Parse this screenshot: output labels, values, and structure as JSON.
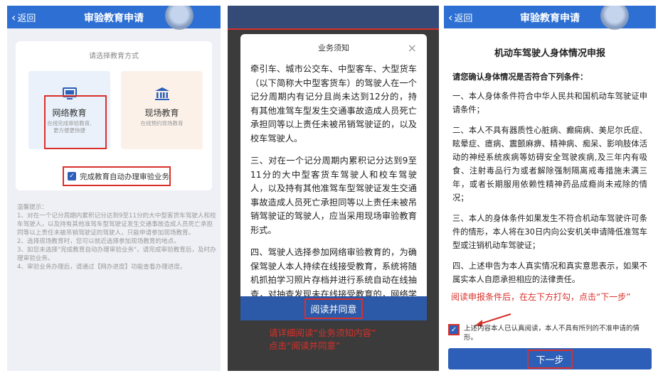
{
  "panel1": {
    "back_label": "返回",
    "title": "审验教育申请",
    "choose_hint": "请选择教育方式",
    "network": {
      "label": "网络教育",
      "sub": "在线完成审验教育,\n更方便更快捷"
    },
    "site": {
      "label": "现场教育",
      "sub": "在线预约现场教育"
    },
    "auto_option": "完成教育自动办理审验业务",
    "tips": [
      "温馨提示：",
      "1、对在一个记分周期内累积记分达到9至11分的大中型客货车驾驶人和校车驾驶人，以及持有其他准驾车型驾驶证发生交通事故造成人员死亡承担同等以上责任未被吊销驾驶证的驾驶人，只能申请参加现场教育。",
      "2、选择现场教育时，您可以就近选择参加现场教育的地点。",
      "3、如您未选择\"完成教育自动办理审验业务\"，请完成审验教育后，及时办理审验业务。",
      "4、审验业务办理后，请通过【网办进度】功能查看办理进度。"
    ]
  },
  "panel2": {
    "modal_title": "业务须知",
    "close": "×",
    "paragraphs": [
      "牵引车、城市公交车、中型客车、大型货车（以下简称大中型客货车）的驾驶人在一个记分周期内有记分且尚未达到12分的，持有其他准驾车型发生交通事故造成人员死亡承担同等以上责任未被吊销驾驶证的，以及校车驾驶人。",
      "三、对在一个记分周期内累积记分达到9至11分的大中型客货车驾驶人和校车驾驶人，以及持有其他准驾车型驾驶证发生交通事故造成人员死亡承担同等以上责任未被吊销驾驶证的驾驶人，应当采用现场审验教育形式。",
      "四、驾驶人选择参加网络审验教育的，为确保驾驶人本人持续在线接受教育，系统将随机抓拍学习照片存档并进行系统自动在线抽查，对抽查发现未在线接受教育的，网络学习学时作废，只能通过现场学习完成审验教育。一日内在线审验教育时间应不少于3小时，并且实人审核通过后，视为完成审验教"
    ],
    "agree_button": "阅读并同意",
    "note_lines": [
      "请详细阅读“业务须知内容”",
      "点击“阅读并同意”"
    ]
  },
  "panel3": {
    "back_label": "返回",
    "title": "审验教育申请",
    "doc_title": "机动车驾驶人身体情况申报",
    "question": "请您确认身体情况是否符合下列条件：",
    "items": [
      "一、本人身体条件符合中华人民共和国机动车驾驶证申请条件；",
      "二、本人不具有器质性心脏病、癫痫病、美尼尔氏症、眩晕症、癔病、震颤麻痹、精神病、痴呆、影响肢体活动的神经系统疾病等妨碍安全驾驶疾病,及三年内有吸食、注射毒品行为或者解除强制隔离戒毒措施未满三年，或者长期服用依赖性精神药品成瘾尚未戒除的情况；",
      "三、本人的身体条件如果发生不符合机动车驾驶许可条件的情形，本人将在30日内向公安机关申请降低准驾车型或注销机动车驾驶证；",
      "四、上述申告为本人真实情况和真实意思表示，如果不属实本人自愿承担相应的法律责任。"
    ],
    "note": "阅读申报条件后，在左下方打勾，点击“下一步”",
    "confirm_text": "上述内容本人已认真阅读，本人不具有所列的不准申请的情形。",
    "next_button": "下一步"
  },
  "colors": {
    "accent": "#2d6fd2",
    "annotation": "#d9302a"
  }
}
